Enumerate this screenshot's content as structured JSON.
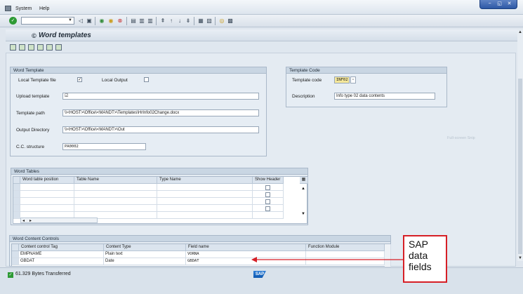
{
  "menu": {
    "items": [
      "System",
      "Help"
    ]
  },
  "window_buttons": [
    "−",
    "◱",
    "✕"
  ],
  "toolbar": {
    "command_field": ""
  },
  "header": {
    "title": "Word templates"
  },
  "word_template": {
    "title": "Word Template",
    "local_template_label": "Local Template file",
    "local_template_checked": "✓",
    "local_output_label": "Local Output",
    "upload_label": "Upload template",
    "upload_value": "☑",
    "template_path_label": "Template path",
    "template_path_value": "\\\\<HOST>\\Office\\<MANDT>\\Templates\\HrInfo02Change.docx",
    "output_dir_label": "Output Directory",
    "output_dir_value": "\\\\<HOST>\\Office\\<MANDT>\\Out",
    "cc_structure_label": "C.C. structure",
    "cc_structure_value": "PA0002"
  },
  "template_code": {
    "title": "Template Code",
    "code_label": "Template code",
    "code_value": "INF02",
    "description_label": "Description",
    "description_value": "Info type 02 data contents"
  },
  "word_tables": {
    "title": "Word Tables",
    "columns": [
      "Word table position",
      "Table Name",
      "Type Name",
      "Show Header"
    ]
  },
  "content_controls": {
    "title": "Word Content Controls",
    "columns": [
      "Content control Tag",
      "Content Type",
      "Field name",
      "Function Module"
    ],
    "rows": [
      {
        "tag": "EMPNAME",
        "type": "Plain text",
        "field": "VORNA",
        "fm": ""
      },
      {
        "tag": "GBDAT",
        "type": "Date",
        "field": "GBDAT",
        "fm": ""
      }
    ]
  },
  "status": {
    "text": "61.329 Bytes Transferred"
  },
  "annotation": {
    "text": "SAP\ndata\nfields",
    "color": "#d61f26"
  },
  "watermark": {
    "text": "Full-screen Snip"
  }
}
